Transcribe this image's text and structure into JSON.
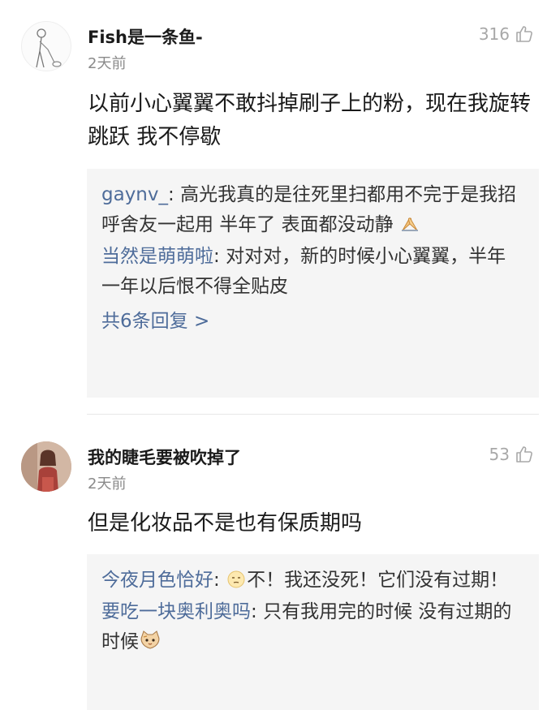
{
  "comments": [
    {
      "author": "Fish是一条鱼-",
      "time": "2天前",
      "likes": "316",
      "text": "以前小心翼翼不敢抖掉刷子上的粉，现在我旋转跳跃 我不停歇",
      "replies": [
        {
          "author": "gaynv_",
          "sep": ": ",
          "text": "高光我真的是往死里扫都用不完于是我招呼舍友一起用 半年了 表面都没动静",
          "emoji": "praying-hands-icon"
        },
        {
          "author": "当然是萌萌啦",
          "sep": ": ",
          "text": "对对对，新的时候小心翼翼，半年一年以后恨不得全贴皮"
        }
      ],
      "more": "共6条回复 >"
    },
    {
      "author": "我的睫毛要被吹掉了",
      "time": "2天前",
      "likes": "53",
      "text": "但是化妆品不是也有保质期吗",
      "replies": [
        {
          "author": "今夜月色恰好",
          "sep": ": ",
          "text_before": "",
          "text": "不！我还没死！它们没有过期！",
          "emoji_before": "smiley-face-icon"
        },
        {
          "author": "要吃一块奥利奥吗",
          "sep": ": ",
          "text": "只有我用完的时候 没有过期的时候",
          "emoji": "cat-face-icon"
        }
      ]
    }
  ]
}
